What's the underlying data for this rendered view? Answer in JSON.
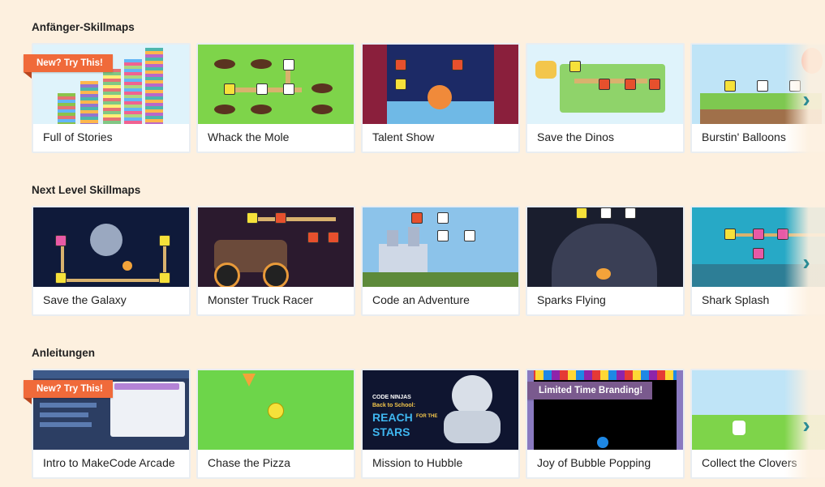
{
  "sections": [
    {
      "title": "Anfänger-Skillmaps",
      "cards": [
        {
          "label": "Full of Stories",
          "badge": "New? Try This!"
        },
        {
          "label": "Whack the Mole"
        },
        {
          "label": "Talent Show"
        },
        {
          "label": "Save the Dinos"
        },
        {
          "label": "Burstin' Balloons"
        }
      ]
    },
    {
      "title": "Next Level Skillmaps",
      "cards": [
        {
          "label": "Save the Galaxy"
        },
        {
          "label": "Monster Truck Racer"
        },
        {
          "label": "Code an Adventure"
        },
        {
          "label": "Sparks Flying"
        },
        {
          "label": "Shark Splash"
        }
      ]
    },
    {
      "title": "Anleitungen",
      "cards": [
        {
          "label": "Intro to MakeCode Arcade",
          "badge": "New? Try This!"
        },
        {
          "label": "Chase the Pizza"
        },
        {
          "label": "Mission to Hubble",
          "thumb_text": [
            "CODE NINJAS",
            "Back to School:",
            "REACH",
            "FOR THE",
            "STARS"
          ]
        },
        {
          "label": "Joy of Bubble Popping",
          "badge": "Limited Time Branding!"
        },
        {
          "label": "Collect the Clovers"
        }
      ]
    }
  ],
  "icons": {
    "next_arrow": "chevron-right-icon"
  },
  "colors": {
    "background": "#fdf0df",
    "badge_orange": "#f06a3a",
    "badge_purple": "#7a5a8e",
    "arrow": "#2a8b94"
  }
}
